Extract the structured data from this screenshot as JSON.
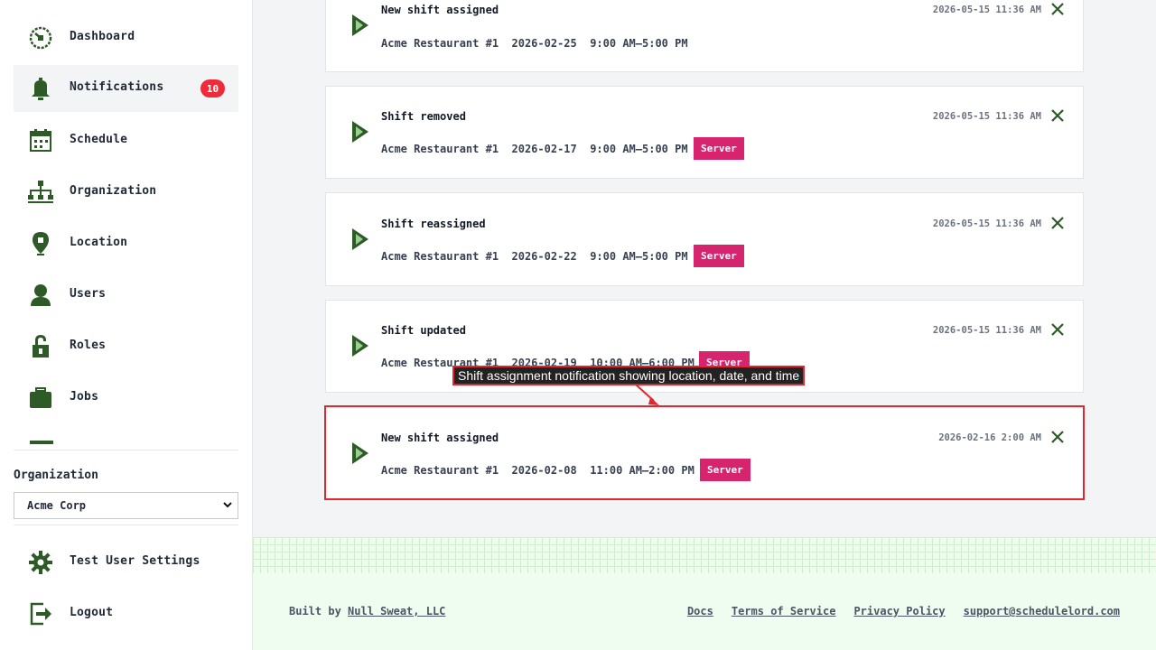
{
  "sidebar": {
    "items": [
      {
        "label": "Dashboard",
        "icon": "dashboard-icon"
      },
      {
        "label": "Notifications",
        "icon": "bell-icon",
        "badge": "10",
        "active": true
      },
      {
        "label": "Schedule",
        "icon": "calendar-icon"
      },
      {
        "label": "Organization",
        "icon": "org-chart-icon"
      },
      {
        "label": "Location",
        "icon": "map-pin-icon"
      },
      {
        "label": "Users",
        "icon": "user-icon"
      },
      {
        "label": "Roles",
        "icon": "lock-icon"
      },
      {
        "label": "Jobs",
        "icon": "briefcase-icon"
      }
    ],
    "org_label": "Organization",
    "org_selected": "Acme Corp",
    "bottom_items": [
      {
        "label": "Test User Settings",
        "icon": "gear-icon"
      },
      {
        "label": "Logout",
        "icon": "logout-icon"
      }
    ]
  },
  "notifications": [
    {
      "title": "New shift assigned",
      "time": "2026-05-15 11:36 AM",
      "location": "Acme Restaurant #1",
      "date": "2026-02-25",
      "hours": "9:00 AM–5:00 PM",
      "role": ""
    },
    {
      "title": "Shift removed",
      "time": "2026-05-15 11:36 AM",
      "location": "Acme Restaurant #1",
      "date": "2026-02-17",
      "hours": "9:00 AM–5:00 PM",
      "role": "Server"
    },
    {
      "title": "Shift reassigned",
      "time": "2026-05-15 11:36 AM",
      "location": "Acme Restaurant #1",
      "date": "2026-02-22",
      "hours": "9:00 AM–5:00 PM",
      "role": "Server"
    },
    {
      "title": "Shift updated",
      "time": "2026-05-15 11:36 AM",
      "location": "Acme Restaurant #1",
      "date": "2026-02-19",
      "hours": "10:00 AM–6:00 PM",
      "role": "Server"
    },
    {
      "title": "New shift assigned",
      "time": "2026-02-16 2:00 AM",
      "location": "Acme Restaurant #1",
      "date": "2026-02-08",
      "hours": "11:00 AM–2:00 PM",
      "role": "Server"
    }
  ],
  "tooltip": "Shift assignment notification showing location, date, and time",
  "footer": {
    "built_prefix": "Built by ",
    "built_link": "Null Sweat, LLC",
    "links": [
      "Docs",
      "Terms of Service",
      "Privacy Policy",
      "support@schedulelord.com"
    ]
  },
  "colors": {
    "accent_green": "#2d5a27",
    "badge_red": "#ef2b3a",
    "role_pink": "#d6246e",
    "highlight_red": "#e0262e"
  }
}
